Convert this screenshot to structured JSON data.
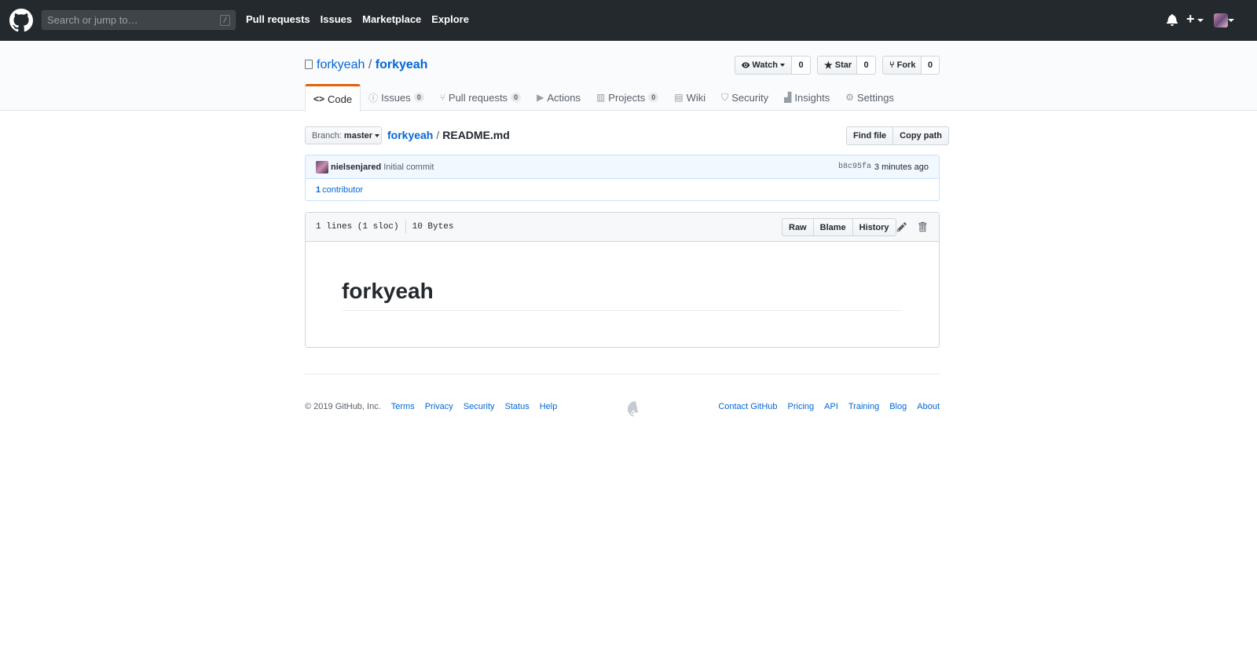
{
  "header": {
    "search_placeholder": "Search or jump to…",
    "search_key": "/",
    "nav": [
      "Pull requests",
      "Issues",
      "Marketplace",
      "Explore"
    ]
  },
  "repo": {
    "owner": "forkyeah",
    "separator": "/",
    "name": "forkyeah",
    "watch_label": "Watch",
    "watch_count": "0",
    "star_label": "Star",
    "star_count": "0",
    "fork_label": "Fork",
    "fork_count": "0"
  },
  "tabs": [
    {
      "label": "Code",
      "icon": "<>",
      "counter": ""
    },
    {
      "label": "Issues",
      "icon": "ⓘ",
      "counter": "0"
    },
    {
      "label": "Pull requests",
      "icon": "⑂",
      "counter": "0"
    },
    {
      "label": "Actions",
      "icon": "▶",
      "counter": ""
    },
    {
      "label": "Projects",
      "icon": "▥",
      "counter": "0"
    },
    {
      "label": "Wiki",
      "icon": "▤",
      "counter": ""
    },
    {
      "label": "Security",
      "icon": "⛉",
      "counter": ""
    },
    {
      "label": "Insights",
      "icon": "▟",
      "counter": ""
    },
    {
      "label": "Settings",
      "icon": "⚙",
      "counter": ""
    }
  ],
  "file_nav": {
    "branch_prefix": "Branch:",
    "branch": "master",
    "repo_link": "forkyeah",
    "sep": "/",
    "file": "README.md",
    "find_file": "Find file",
    "copy_path": "Copy path"
  },
  "commit": {
    "author": "nielsenjared",
    "message": "Initial commit",
    "sha": "b8c95fa",
    "time": "3 minutes ago",
    "contributors_count": "1",
    "contributors_label": "contributor"
  },
  "file": {
    "lines": "1 lines (1 sloc)",
    "size": "10 Bytes",
    "raw": "Raw",
    "blame": "Blame",
    "history": "History",
    "heading": "forkyeah"
  },
  "footer": {
    "copyright": "© 2019 GitHub, Inc.",
    "left_links": [
      "Terms",
      "Privacy",
      "Security",
      "Status",
      "Help"
    ],
    "right_links": [
      "Contact GitHub",
      "Pricing",
      "API",
      "Training",
      "Blog",
      "About"
    ]
  },
  "colors": {
    "header_bg": "#24292e",
    "link": "#0366d6",
    "tab_accent": "#e36209"
  }
}
